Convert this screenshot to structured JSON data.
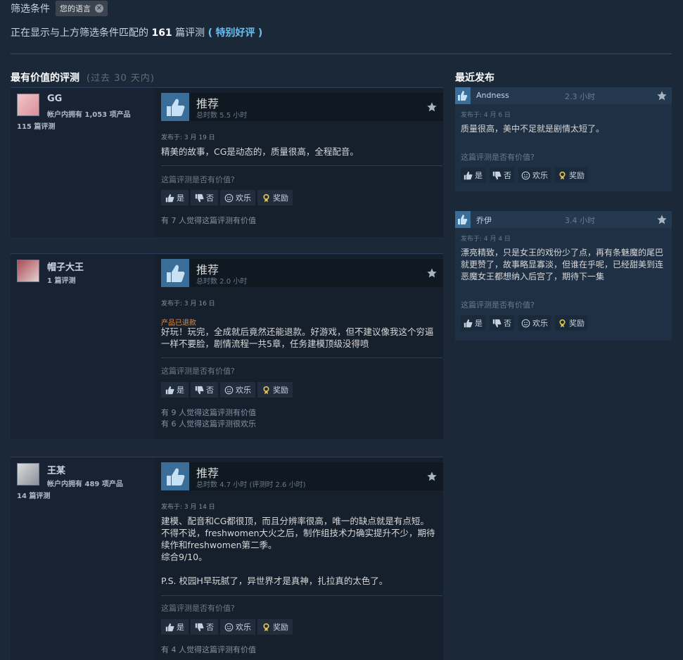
{
  "filter": {
    "label": "筛选条件",
    "chip": "您的语言"
  },
  "summary": {
    "prefix": "正在显示与上方筛选条件匹配的",
    "count": "161",
    "suffix": "篇评测",
    "paren_open": "(",
    "rating": "特别好评",
    "paren_close": ")"
  },
  "left_title": "最有价值的评测",
  "left_sub": "(过去 30 天内)",
  "right_title": "最近发布",
  "common": {
    "recommended": "推荐",
    "helpful_q": "这篇评测是否有价值?",
    "yes": "是",
    "no": "否",
    "funny": "欢乐",
    "award": "奖励"
  },
  "reviews": [
    {
      "author": "GG",
      "products": "帐户内拥有 1,053 项产品",
      "review_count": "115 篇评测",
      "hours": "总时数 5.5 小时",
      "posted": "发布于: 3 月 19 日",
      "refund": "",
      "text": "精美的故事，CG是动态的，质量很高，全程配音。",
      "helpful": [
        "有 7 人觉得这篇评测有价值"
      ]
    },
    {
      "author": "帽子大王",
      "products": "",
      "review_count": "1 篇评测",
      "hours": "总时数 2.0 小时",
      "posted": "发布于: 3 月 16 日",
      "refund": "产品已退款",
      "text": "好玩！玩完，全成就后竟然还能退款。好游戏，但不建议像我这个穷逼一样不要脸，剧情流程一共5章，任务建模顶级没得喷",
      "helpful": [
        "有 9 人觉得这篇评测有价值",
        "有 6 人觉得这篇评测很欢乐"
      ]
    },
    {
      "author": "王某",
      "products": "帐户内拥有 489 项产品",
      "review_count": "14 篇评测",
      "hours": "总时数 4.7 小时 (评测时 2.6 小时)",
      "posted": "发布于: 3 月 14 日",
      "refund": "",
      "text_lines": [
        "建模、配音和CG都很顶，而且分辨率很高，唯一的缺点就是有点短。不得不说，freshwomen大火之后，制作组技术力确实提升不少，期待续作和freshwomen第二季。",
        "综合9/10。",
        "",
        "P.S. 校园H早玩腻了，异世界才是真神，扎拉真的太色了。"
      ],
      "helpful": [
        "有 4 人觉得这篇评测有价值"
      ]
    }
  ],
  "recent": [
    {
      "name": "Andness",
      "hours": "2.3 小时",
      "posted": "发布于: 4 月 6 日",
      "text": "质量很高，美中不足就是剧情太短了。"
    },
    {
      "name": "乔伊",
      "hours": "3.4 小时",
      "posted": "发布于: 4 月 4 日",
      "text": "漂亮精致，只是女王的戏份少了点，再有条魅魔的尾巴就更赞了，故事略显寡淡，但谁在乎呢，已经甜美到连恶魔女王都想纳入后宫了，期待下一集"
    }
  ]
}
